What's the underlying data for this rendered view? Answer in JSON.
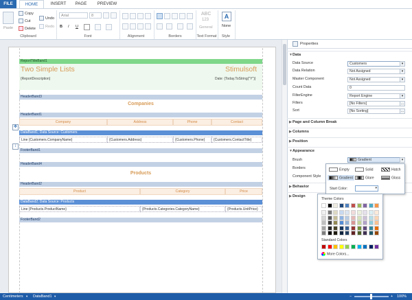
{
  "tabs": {
    "file": "FILE",
    "home": "HOME",
    "insert": "INSERT",
    "page": "PAGE",
    "preview": "PREVIEW"
  },
  "ribbon": {
    "paste": "Paste",
    "copy": "Copy",
    "cut": "Cut",
    "delete": "Delete",
    "undo": "Undo",
    "redo": "Redo",
    "font_family": "Arial",
    "font_size": "8",
    "groups": {
      "clipboard": "Clipboard",
      "font": "Font",
      "alignment": "Alignment",
      "borders": "Borders",
      "text_format": "Text Format",
      "style": "Style"
    },
    "text_format_sample": "ABC",
    "text_format_num": "123",
    "text_format_label": "General",
    "style_label": "None"
  },
  "report": {
    "report_title_band": "ReportTitleBand1",
    "title": "Two Simple Lists",
    "brand": "Stimulsoft",
    "report_description": "{ReportDescription}",
    "date_expr": "Date: {Today.ToString(\"Y\")}",
    "header_band3": "HeaderBand3",
    "companies": "Companies",
    "header_band1": "HeaderBand1",
    "cols1": [
      "Company",
      "Address",
      "Phone",
      "Contact"
    ],
    "data_band1": "DataBand1; Data Source: Customers",
    "line1": [
      "Line {Customers.CompanyName}",
      "{Customers.Address}",
      "{Customers.Phone}",
      "{Customers.ContactTitle}"
    ],
    "footer_band1": "FooterBand1",
    "header_band4": "HeaderBand4",
    "products": "Products",
    "header_band2": "HeaderBand2",
    "cols2": [
      "Product",
      "Category",
      "Price"
    ],
    "data_band2": "DataBand2; Data Source: Products",
    "line2": [
      "Line {Products.ProductName}",
      "{Products.Categories.CategoryName}",
      "{Products.UnitPrice}"
    ],
    "footer_band2": "FooterBand2"
  },
  "panel": {
    "title": "Properties",
    "sections": {
      "data": "Data",
      "page_column_break": "Page and Column Break",
      "columns": "Columns",
      "position": "Position",
      "appearance": "Appearance",
      "behavior": "Behavior",
      "design": "Design"
    },
    "props": [
      {
        "label": "Data Source",
        "value": "Customers"
      },
      {
        "label": "Data Relation",
        "value": "Not Assigned"
      },
      {
        "label": "Master Component",
        "value": "Not Assigned"
      },
      {
        "label": "Count Data",
        "value": "0"
      },
      {
        "label": "FilterEngine",
        "value": "Report Engine"
      },
      {
        "label": "Filters",
        "value": "[No Filters]"
      },
      {
        "label": "Sort",
        "value": "[No Sorting]"
      }
    ],
    "brush_label": "Brush",
    "brush_value": "Gradient",
    "borders_label": "Borders",
    "component_style_label": "Component Style"
  },
  "brush_popup": {
    "options": [
      "Empty",
      "Solid",
      "Hatch",
      "Gradient",
      "Glare",
      "Glass"
    ],
    "start_color": "Start Color:"
  },
  "color_popup": {
    "theme_colors": "Theme Colors",
    "standard_colors": "Standard Colors",
    "more_colors": "More Colors...",
    "theme_top": [
      "#ffffff",
      "#000000",
      "#eeece1",
      "#1f497d",
      "#4f81bd",
      "#c0504d",
      "#9bbb59",
      "#8064a2",
      "#4bacc6",
      "#f79646"
    ],
    "theme_cols": [
      [
        "#f2f2f2",
        "#d8d8d8",
        "#bfbfbf",
        "#a5a5a5",
        "#7f7f7f"
      ],
      [
        "#7f7f7f",
        "#595959",
        "#3f3f3f",
        "#262626",
        "#0c0c0c"
      ],
      [
        "#ddd9c3",
        "#c4bd97",
        "#938953",
        "#494429",
        "#1d1b10"
      ],
      [
        "#c6d9f0",
        "#8db3e2",
        "#548dd4",
        "#17365d",
        "#0f243e"
      ],
      [
        "#dbe5f1",
        "#b8cce4",
        "#95b3d7",
        "#366092",
        "#244061"
      ],
      [
        "#f2dcdb",
        "#e5b9b7",
        "#d99694",
        "#953734",
        "#632423"
      ],
      [
        "#ebf1dd",
        "#d7e3bc",
        "#c3d69b",
        "#76923c",
        "#4f6128"
      ],
      [
        "#e5e0ec",
        "#ccc1d9",
        "#b2a2c7",
        "#5f497a",
        "#3f3151"
      ],
      [
        "#dbeef3",
        "#b7dde8",
        "#92cddc",
        "#31859b",
        "#205867"
      ],
      [
        "#fdeada",
        "#fbd5b5",
        "#fac08f",
        "#e36c09",
        "#974806"
      ]
    ],
    "standard": [
      "#c00000",
      "#ff0000",
      "#ffc000",
      "#ffff00",
      "#92d050",
      "#00b050",
      "#00b0f0",
      "#0070c0",
      "#002060",
      "#7030a0"
    ]
  },
  "status": {
    "units": "Centimeters",
    "component": "DataBand1",
    "zoom": "100%"
  }
}
